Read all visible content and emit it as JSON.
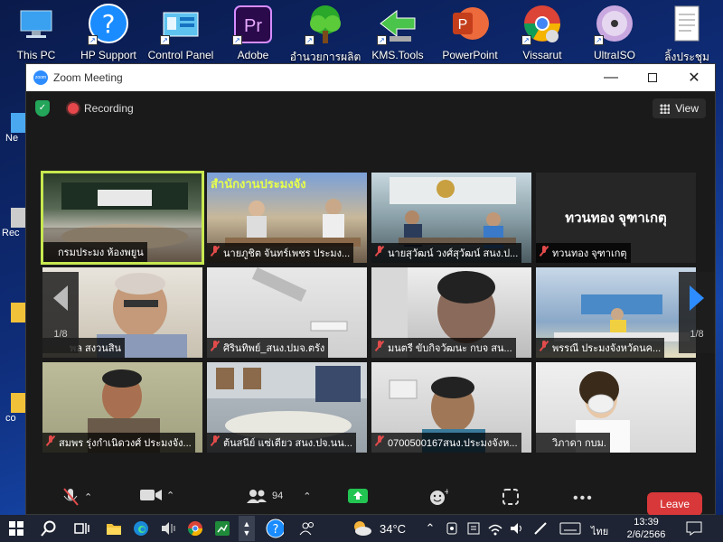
{
  "desktop": {
    "icons": [
      {
        "label": "This PC",
        "icon": "this-pc-icon"
      },
      {
        "label": "HP Support",
        "icon": "help-question-icon"
      },
      {
        "label": "Control Panel",
        "icon": "control-panel-icon"
      },
      {
        "label": "Adobe",
        "icon": "premiere-pro-icon"
      },
      {
        "label": "อำนวยการผลิต",
        "icon": "tree-icon"
      },
      {
        "label": "KMS.Tools",
        "icon": "kms-tools-icon"
      },
      {
        "label": "PowerPoint",
        "icon": "powerpoint-icon"
      },
      {
        "label": "Vissarut",
        "icon": "chrome-icon"
      },
      {
        "label": "UltraISO",
        "icon": "disc-icon"
      },
      {
        "label": "ลิ้งประชุม",
        "icon": "document-icon"
      }
    ],
    "left_labels": [
      "Ne",
      "Rec",
      "co"
    ],
    "premiere_glyph": "Pr",
    "powerpoint_glyph": "P"
  },
  "zoom": {
    "window_title": "Zoom Meeting",
    "logo_text": "zoom",
    "recording_label": "Recording",
    "view_label": "View",
    "page_indicator": "1/8",
    "participants": [
      {
        "name": "กรมประมง ห้องพยูน",
        "muted": false,
        "active": true
      },
      {
        "name": "นายภูชิต จันทร์เพชร ประมง...",
        "muted": true,
        "overlay": "สำนักงานประมงจัง"
      },
      {
        "name": "นายสุวัฒน์ วงศ์สุวัฒน์ สนง.ป...",
        "muted": true
      },
      {
        "name": "ทวนทอง จุฑาเกตุ",
        "muted": true,
        "center_text": "ทวนทอง จุฑาเกตุ"
      },
      {
        "name": "พล สงวนสิน",
        "muted": false
      },
      {
        "name": "ศิรินทิพย์_สนง.ปมจ.ตรัง",
        "muted": true
      },
      {
        "name": "มนตรี ขับกิจวัฒนะ กบจ สน...",
        "muted": true
      },
      {
        "name": "พรรณี ประมงจังหวัดนค...",
        "muted": true
      },
      {
        "name": "สมพร รุ่งกำเนิดวงศ์ ประมงจัง...",
        "muted": true
      },
      {
        "name": "ต้นสนีย์ แซ่เตียว สนง.ปจ.นน...",
        "muted": true
      },
      {
        "name": "0700500167สนง.ประมงจังห...",
        "muted": true
      },
      {
        "name": "วิภาดา กบม.",
        "muted": false
      }
    ],
    "toolbar": {
      "participants_count": "94",
      "leave_label": "Leave"
    }
  },
  "taskbar": {
    "temperature": "34°C",
    "language": "ไทย",
    "time": "13:39",
    "date": "2/6/2566"
  }
}
